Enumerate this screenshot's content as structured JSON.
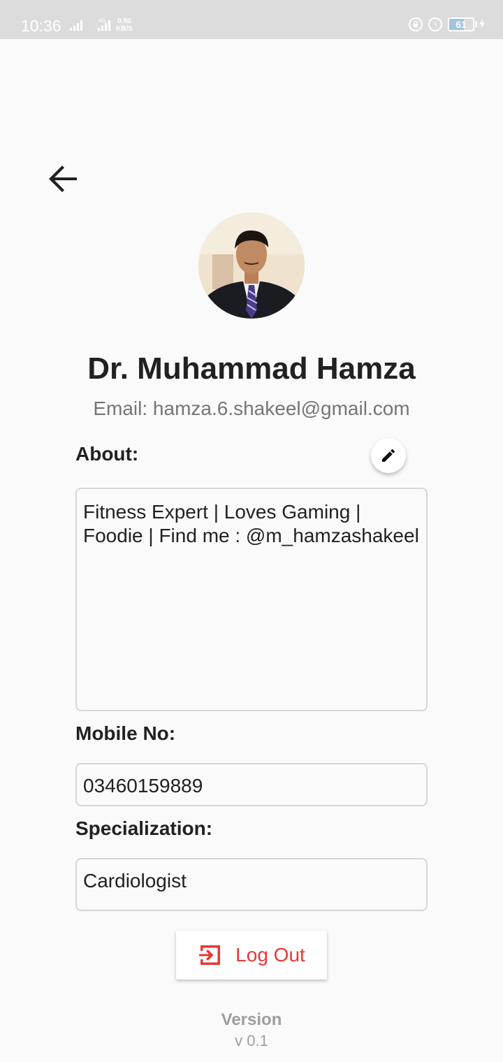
{
  "status_bar": {
    "time": "10:36",
    "net_speed_value": "0.50",
    "net_speed_unit": "KB/S",
    "network_label_1": "4G",
    "battery_level": "61",
    "battery_fraction": 0.61,
    "icons": [
      "signal-icon",
      "signal-icon",
      "lock-rotation-icon",
      "alarm-icon",
      "battery-icon",
      "charging-icon"
    ]
  },
  "header": {
    "back_icon": "arrow-back-icon"
  },
  "profile": {
    "name": "Dr. Muhammad Hamza",
    "email": "Email: hamza.6.shakeel@gmail.com"
  },
  "about": {
    "label": "About:",
    "edit_icon": "pencil-icon",
    "value": "Fitness Expert | Loves Gaming | Foodie | Find me : @m_hamzashakeel"
  },
  "mobile": {
    "label": "Mobile No:",
    "value": "03460159889"
  },
  "specialization": {
    "label": "Specialization:",
    "value": "Cardiologist"
  },
  "logout": {
    "label": "Log Out",
    "icon": "exit-icon",
    "color": "#e53935"
  },
  "footer": {
    "version_title": "Version",
    "version_number": "v 0.1"
  }
}
